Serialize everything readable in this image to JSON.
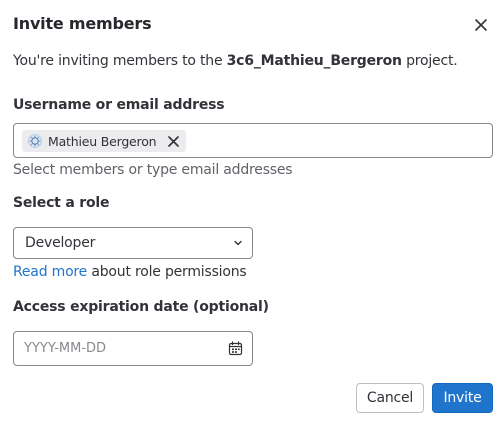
{
  "dialog": {
    "title": "Invite members",
    "intro_prefix": "You're inviting members to the ",
    "project_name": "3c6_Mathieu_Bergeron",
    "intro_suffix": " project."
  },
  "member_field": {
    "label": "Username or email address",
    "tokens": [
      {
        "name": "Mathieu Bergeron",
        "avatar_icon": "user-avatar-icon"
      }
    ],
    "helper": "Select members or type email addresses"
  },
  "role_field": {
    "label": "Select a role",
    "selected": "Developer",
    "link_text": "Read more",
    "link_suffix": " about role permissions"
  },
  "expiration_field": {
    "label": "Access expiration date (optional)",
    "placeholder": "YYYY-MM-DD",
    "value": ""
  },
  "footer": {
    "cancel_label": "Cancel",
    "invite_label": "Invite"
  },
  "colors": {
    "primary": "#1f75cb",
    "link": "#1f75cb",
    "border": "#89888d"
  }
}
